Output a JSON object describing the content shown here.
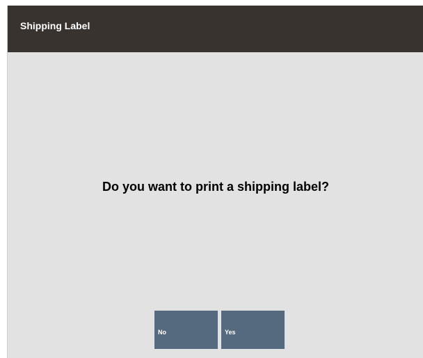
{
  "header": {
    "title": "Shipping Label"
  },
  "prompt": {
    "message": "Do you want to print a shipping label?"
  },
  "buttons": {
    "no_label": "No",
    "yes_label": "Yes"
  },
  "colors": {
    "titlebar": "#38332f",
    "background": "#e2e2e2",
    "button": "#566a7f"
  }
}
